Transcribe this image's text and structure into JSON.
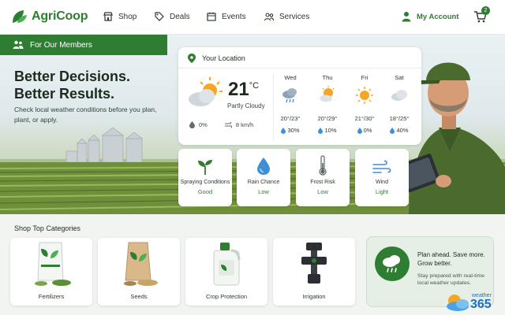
{
  "header": {
    "logo_part1": "Agri",
    "logo_part2": "Coop",
    "nav": [
      {
        "label": "Shop",
        "icon": "store-icon"
      },
      {
        "label": "Deals",
        "icon": "tag-icon"
      },
      {
        "label": "Events",
        "icon": "calendar-icon"
      },
      {
        "label": "Services",
        "icon": "people-icon"
      }
    ],
    "account_label": "My Account",
    "cart_count": "2"
  },
  "hero": {
    "members_label": "For Our Members",
    "title_line1": "Better Decisions.",
    "title_line2": "Better Results.",
    "subtitle": "Check local weather conditions before you plan, plant, or apply."
  },
  "weather": {
    "location_label": "Your Location",
    "current": {
      "temp": "21",
      "unit": "°C",
      "condition": "Partly Cloudy",
      "precip": "0%",
      "wind": "8 km/h"
    },
    "forecast": [
      {
        "day": "Wed",
        "temps": "20°/23°",
        "precip": "30%",
        "icon": "rain-cloud-icon"
      },
      {
        "day": "Thu",
        "temps": "20°/29°",
        "precip": "10%",
        "icon": "partly-sunny-icon"
      },
      {
        "day": "Fri",
        "temps": "21°/30°",
        "precip": "0%",
        "icon": "sun-icon"
      },
      {
        "day": "Sat",
        "temps": "18°/25°",
        "precip": "40%",
        "icon": "cloud-icon"
      }
    ]
  },
  "conditions": [
    {
      "label": "Spraying Conditions",
      "value": "Good",
      "icon": "sprout-icon"
    },
    {
      "label": "Rain Chance",
      "value": "Low",
      "icon": "water-drop-icon"
    },
    {
      "label": "Frost Risk",
      "value": "Low",
      "icon": "thermometer-icon"
    },
    {
      "label": "Wind",
      "value": "Light",
      "icon": "wind-icon"
    }
  ],
  "shop": {
    "title": "Shop Top Categories",
    "categories": [
      {
        "label": "Fertilizers"
      },
      {
        "label": "Seeds"
      },
      {
        "label": "Crop Protection"
      },
      {
        "label": "Irrigation"
      }
    ]
  },
  "promo": {
    "title": "Plan ahead. Save more. Grow better.",
    "subtitle": "Stay prepared with real-time local weather updates.",
    "brand_small": "weather",
    "brand_big": "365"
  },
  "colors": {
    "brand_green": "#2e7d32",
    "sun": "#f5a623",
    "rain_blue": "#3f8fd8"
  }
}
